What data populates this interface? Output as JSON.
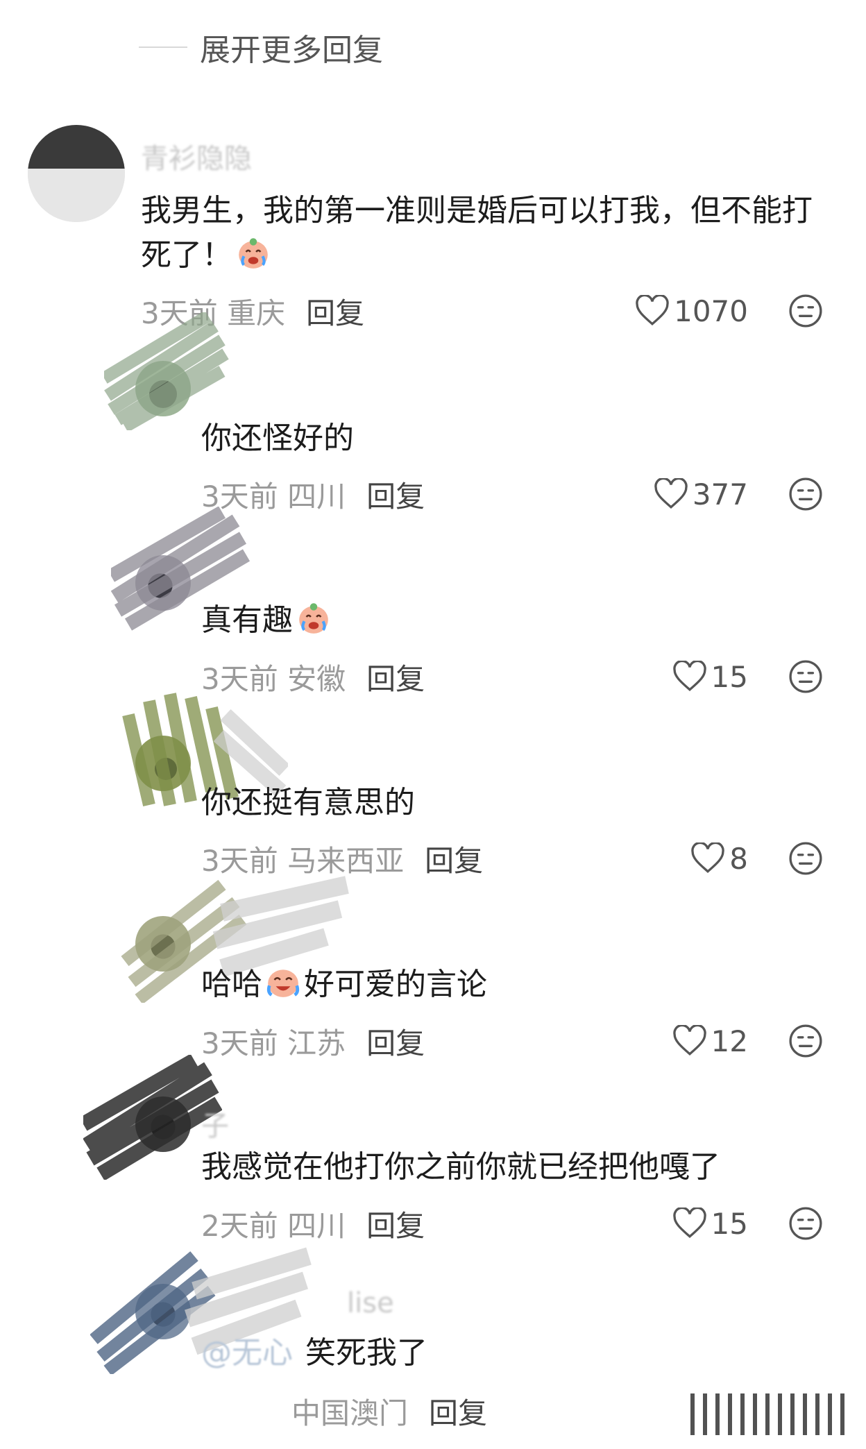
{
  "expand_replies": "展开更多回复",
  "comments": [
    {
      "username": "青衫隐隐",
      "text_before": "我男生，我的第一准则是婚后可以打我，但不能打死了！",
      "time": "3天前",
      "location": "重庆",
      "reply": "回复",
      "likes": "1070",
      "emoji": "crying-laugh-icon"
    },
    {
      "text_before": "你还怪好的",
      "time": "3天前",
      "location": "四川",
      "reply": "回复",
      "likes": "377"
    },
    {
      "text_before": "真有趣",
      "time": "3天前",
      "location": "安徽",
      "reply": "回复",
      "likes": "15",
      "emoji": "crying-laugh-icon"
    },
    {
      "text_before": "你还挺有意思的",
      "time": "3天前",
      "location": "马来西亚",
      "reply": "回复",
      "likes": "8"
    },
    {
      "text_before": "哈哈",
      "text_after": "好可爱的言论",
      "time": "3天前",
      "location": "江苏",
      "reply": "回复",
      "likes": "12",
      "emoji": "laughing-tears-icon"
    },
    {
      "username": "子",
      "text_before": "我感觉在他打你之前你就已经把他嘎了",
      "time": "2天前",
      "location": "四川",
      "reply": "回复",
      "likes": "15"
    },
    {
      "username": "lise",
      "mention": "@无心",
      "text_before": "笑死我了",
      "location": "中国澳门",
      "reply": "回复"
    }
  ],
  "colors": {
    "like_icon": "#555555",
    "meta_text": "#9a9a9a",
    "reply_text": "#444444"
  },
  "icons": {
    "like": "heart-outline-icon",
    "dislike": "neutral-face-icon"
  }
}
